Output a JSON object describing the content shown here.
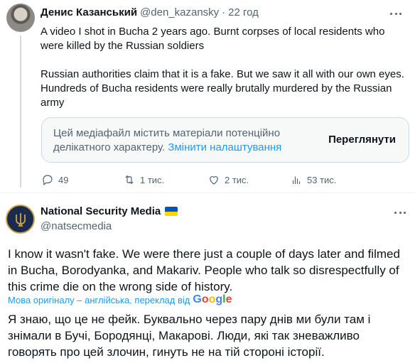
{
  "quoted_tweet": {
    "author_name": "Денис Казанський",
    "handle": "@den_kazansky",
    "separator": "·",
    "time": "22 год",
    "paragraphs": [
      "A video I shot in Bucha 2 years ago. Burnt corpses of local residents who were killed by the Russian soldiers",
      "Russian authorities claim that it is a fake. But we saw it all with our own eyes. Hundreds of Bucha residents were really brutally murdered by the Russian army"
    ],
    "sensitive_notice": {
      "text": "Цей медіафайл містить матеріали потенційно делікатного характеру.",
      "link": "Змінити налаштування",
      "button": "Переглянути"
    },
    "actions": {
      "replies": "49",
      "reposts": "1 тис.",
      "likes": "2 тис.",
      "views": "53 тис."
    }
  },
  "reply_tweet": {
    "author_name": "National Security Media",
    "handle": "@natsecmedia",
    "text": "I know it wasn't fake. We were there just a couple of days later and filmed in Bucha, Borodyanka, and Makariv. People who talk so disrespectfully of this crime die on the wrong side of history.",
    "translation_label": "Мова оригіналу – англійська, переклад від",
    "translation_provider": "Google",
    "translated_text": "Я знаю, що це не фейк. Буквально через пару днів ми були там і знімали в Бучі, Бородянці, Макарові. Люди, які так зневажливо говорять про цей злочин, гинуть не на тій стороні історії."
  },
  "colors": {
    "text": "#0f1419",
    "secondary": "#536471",
    "link": "#1d9bf0",
    "border": "#cfd9de",
    "flag_blue": "#0057b7",
    "flag_yellow": "#ffd700"
  },
  "icons": [
    "more-icon",
    "reply-icon",
    "repost-icon",
    "like-icon",
    "views-icon",
    "ukraine-flag-icon",
    "trident-icon",
    "google-logo"
  ]
}
